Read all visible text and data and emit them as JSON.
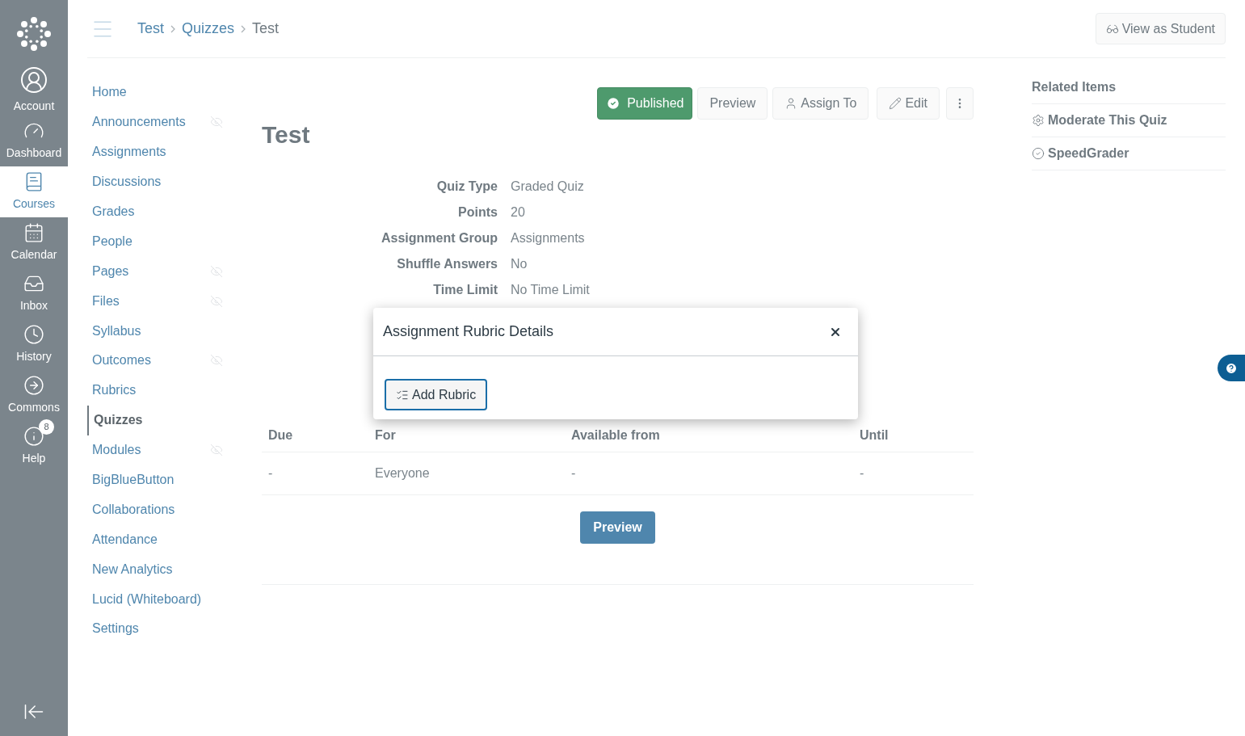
{
  "global_nav": {
    "items": [
      {
        "kind": "account",
        "label": "Account",
        "selected": false
      },
      {
        "kind": "dashboard",
        "label": "Dashboard",
        "selected": false
      },
      {
        "kind": "courses",
        "label": "Courses",
        "selected": true
      },
      {
        "kind": "calendar",
        "label": "Calendar",
        "selected": false
      },
      {
        "kind": "inbox",
        "label": "Inbox",
        "selected": false
      },
      {
        "kind": "history",
        "label": "History",
        "selected": false
      },
      {
        "kind": "commons",
        "label": "Commons",
        "selected": false
      },
      {
        "kind": "help",
        "label": "Help",
        "selected": false,
        "badge": "8"
      }
    ]
  },
  "breadcrumbs": [
    "Test",
    "Quizzes",
    "Test"
  ],
  "view_as_student": "View as Student",
  "course_nav": [
    {
      "label": "Home",
      "hidden": false,
      "selected": false
    },
    {
      "label": "Announcements",
      "hidden": true,
      "selected": false
    },
    {
      "label": "Assignments",
      "hidden": false,
      "selected": false
    },
    {
      "label": "Discussions",
      "hidden": false,
      "selected": false
    },
    {
      "label": "Grades",
      "hidden": false,
      "selected": false
    },
    {
      "label": "People",
      "hidden": false,
      "selected": false
    },
    {
      "label": "Pages",
      "hidden": true,
      "selected": false
    },
    {
      "label": "Files",
      "hidden": true,
      "selected": false
    },
    {
      "label": "Syllabus",
      "hidden": false,
      "selected": false
    },
    {
      "label": "Outcomes",
      "hidden": true,
      "selected": false
    },
    {
      "label": "Rubrics",
      "hidden": false,
      "selected": false
    },
    {
      "label": "Quizzes",
      "hidden": false,
      "selected": true
    },
    {
      "label": "Modules",
      "hidden": true,
      "selected": false
    },
    {
      "label": "BigBlueButton",
      "hidden": false,
      "selected": false
    },
    {
      "label": "Collaborations",
      "hidden": false,
      "selected": false
    },
    {
      "label": "Attendance",
      "hidden": false,
      "selected": false
    },
    {
      "label": "New Analytics",
      "hidden": false,
      "selected": false
    },
    {
      "label": "Lucid (Whiteboard)",
      "hidden": false,
      "selected": false
    },
    {
      "label": "Settings",
      "hidden": false,
      "selected": false
    }
  ],
  "toolbar": [
    {
      "kind": "published",
      "label": "Published"
    },
    {
      "kind": "plain",
      "label": "Preview"
    },
    {
      "kind": "assign",
      "label": "Assign To"
    },
    {
      "kind": "edit",
      "label": "Edit"
    },
    {
      "kind": "more"
    }
  ],
  "title": "Test",
  "details": [
    {
      "label": "Quiz Type",
      "value": "Graded Quiz"
    },
    {
      "label": "Points",
      "value": "20"
    },
    {
      "label": "Assignment Group",
      "value": "Assignments"
    },
    {
      "label": "Shuffle Answers",
      "value": "No"
    },
    {
      "label": "Time Limit",
      "value": "No Time Limit"
    }
  ],
  "table": {
    "columns": [
      "Due",
      "For",
      "Available from",
      "Until"
    ],
    "rows": [
      [
        "-",
        "Everyone",
        "-",
        "-"
      ]
    ]
  },
  "preview_button": "Preview",
  "related_items": {
    "title": "Related Items",
    "items": [
      {
        "kind": "moderate",
        "label": "Moderate This Quiz"
      },
      {
        "kind": "speedgrader",
        "label": "SpeedGrader"
      }
    ]
  },
  "dialog": {
    "title": "Assignment Rubric Details",
    "button": "Add Rubric"
  }
}
